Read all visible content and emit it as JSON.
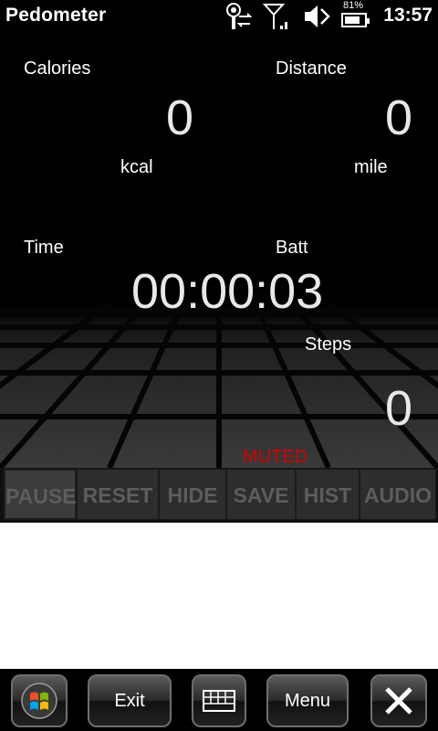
{
  "titlebar": {
    "title": "Pedometer",
    "battery_percent": "81%",
    "battery_level": 0.81,
    "time": "13:57",
    "icons": [
      "connectivity-icon",
      "signal-icon",
      "volume-icon",
      "battery-icon"
    ]
  },
  "stats": {
    "calories": {
      "label": "Calories",
      "value": "0",
      "unit": "kcal"
    },
    "distance": {
      "label": "Distance",
      "value": "0",
      "unit": "mile"
    },
    "time": {
      "label": "Time",
      "value": "00:00:03"
    },
    "batt": {
      "label": "Batt"
    },
    "steps": {
      "label": "Steps",
      "value": "0"
    },
    "audio_status": "MUTED"
  },
  "toolbar": {
    "buttons": [
      {
        "label": "PAUSE"
      },
      {
        "label": "RESET"
      },
      {
        "label": "HIDE"
      },
      {
        "label": "SAVE"
      },
      {
        "label": "HIST"
      },
      {
        "label": "AUDIO"
      }
    ]
  },
  "softkeys": {
    "exit": "Exit",
    "menu": "Menu",
    "icons": [
      "windows-start-icon",
      "keyboard-icon",
      "close-icon"
    ]
  },
  "colors": {
    "muted": "#d40000",
    "toolbar_text": "#5d5d5d"
  }
}
